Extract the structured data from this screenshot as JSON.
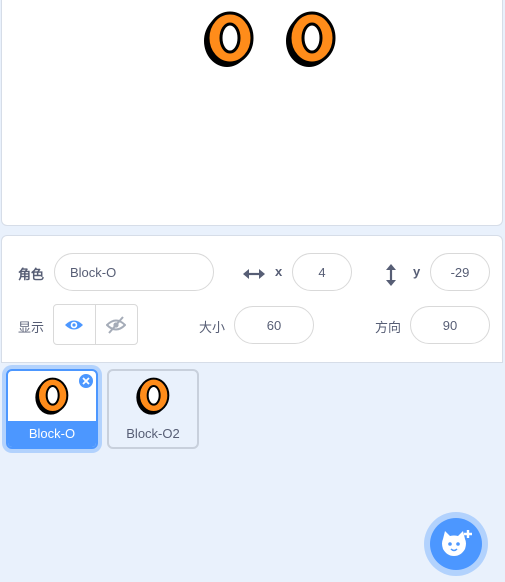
{
  "sprite_info": {
    "sprite_label": "角色",
    "sprite_name": "Block-O",
    "x_label": "x",
    "x_value": "4",
    "y_label": "y",
    "y_value": "-29",
    "show_label": "显示",
    "size_label": "大小",
    "size_value": "60",
    "direction_label": "方向",
    "direction_value": "90"
  },
  "sprites": [
    {
      "name": "Block-O",
      "selected": true
    },
    {
      "name": "Block-O2",
      "selected": false
    }
  ],
  "colors": {
    "accent": "#4c97ff",
    "sprite_fill": "#ff8c1a",
    "sprite_outline": "#000000"
  },
  "icons": {
    "x_arrows": "horizontal-arrows-icon",
    "y_arrows": "vertical-arrows-icon",
    "show": "eye-icon",
    "hide": "eye-slash-icon",
    "delete": "close-icon",
    "add_sprite": "cat-plus-icon"
  }
}
